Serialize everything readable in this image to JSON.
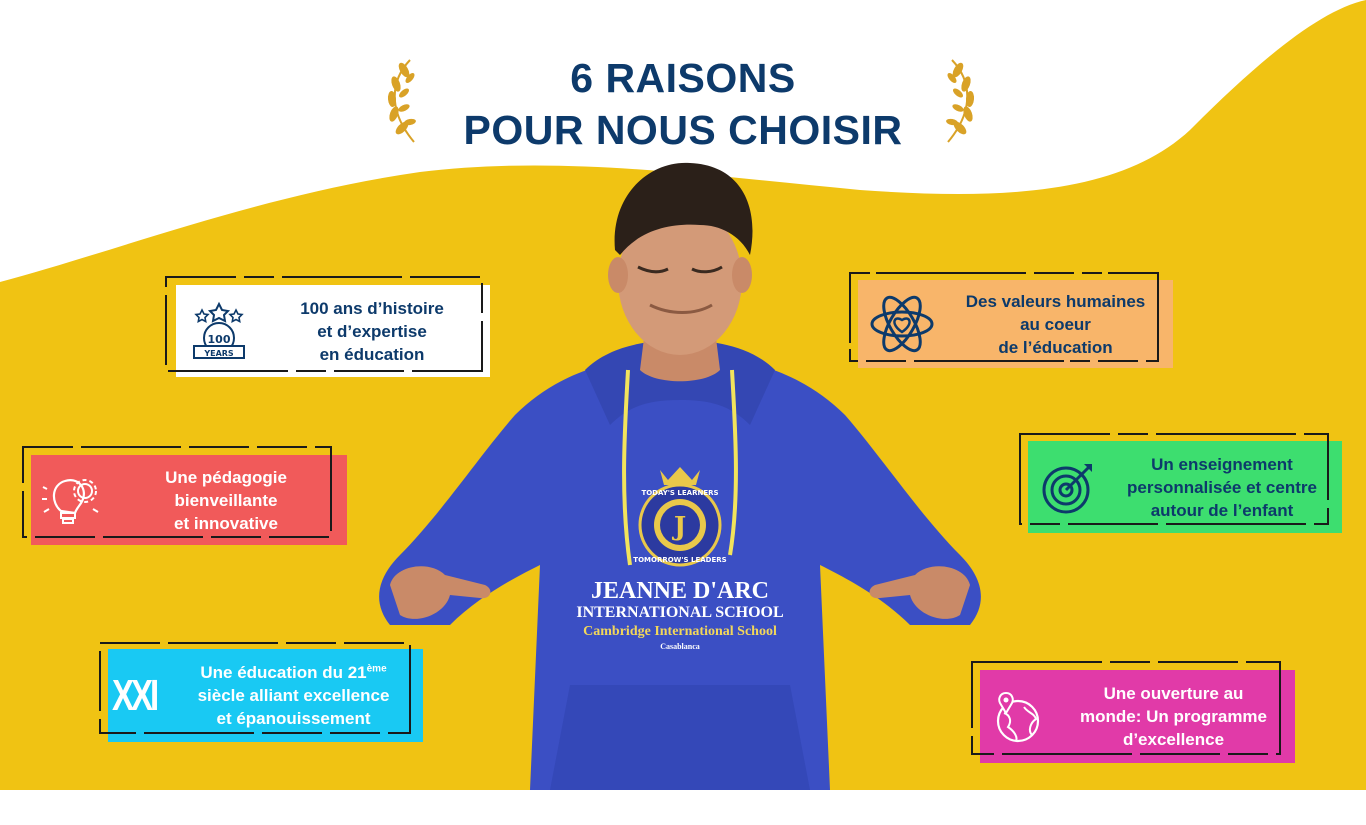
{
  "title": {
    "line1": "6 RAISONS",
    "line2": "POUR NOUS CHOISIR"
  },
  "colors": {
    "yellow": "#f0c313",
    "navy": "#0d3a6b",
    "hoodie": "#3b4fc4",
    "gold": "#d9a227"
  },
  "hoodie": {
    "crest_top": "TODAY'S LEARNERS",
    "crest_bottom": "TOMORROW'S LEADERS",
    "crest_letter": "J",
    "line1": "JEANNE D'ARC",
    "line2": "INTERNATIONAL SCHOOL",
    "line3": "Cambridge International School",
    "line4": "Casablanca"
  },
  "reasons": [
    {
      "icon": "100-years-badge-icon",
      "icon_label_top": "100",
      "icon_label_bottom": "YEARS",
      "text": [
        "100 ans d’histoire",
        "et d’expertise",
        "en éducation"
      ]
    },
    {
      "icon": "atom-heart-icon",
      "text": [
        "Des valeurs humaines",
        "au coeur",
        "de l’éducation"
      ]
    },
    {
      "icon": "lightbulb-gear-icon",
      "text": [
        "Une pédagogie",
        "bienveillante",
        "et innovative"
      ]
    },
    {
      "icon": "target-arrow-icon",
      "text": [
        "Un enseignement",
        "personnalisée et centre",
        "autour de l’enfant"
      ]
    },
    {
      "icon": "xxi-roman-icon",
      "icon_label": "XXI",
      "text_a": "Une éducation du 21",
      "text_sup": "ème",
      "text": [
        "siècle alliant excellence",
        "et épanouissement"
      ]
    },
    {
      "icon": "globe-pin-icon",
      "text": [
        "Une ouverture au",
        "monde: Un programme",
        "d’excellence"
      ]
    }
  ]
}
